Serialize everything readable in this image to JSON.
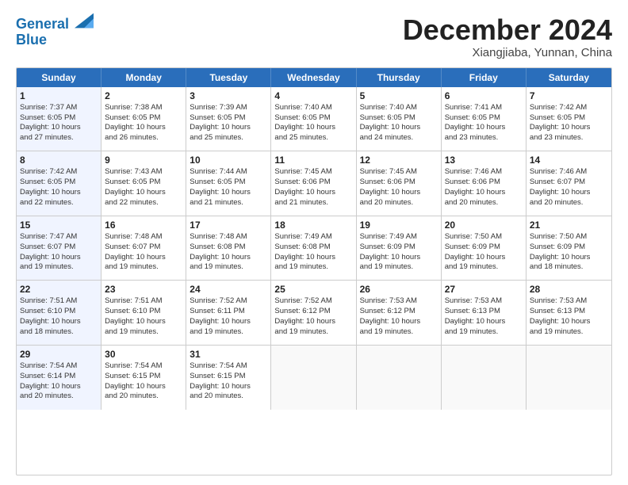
{
  "logo": {
    "line1": "General",
    "line2": "Blue"
  },
  "title": "December 2024",
  "location": "Xiangjiaba, Yunnan, China",
  "weekdays": [
    "Sunday",
    "Monday",
    "Tuesday",
    "Wednesday",
    "Thursday",
    "Friday",
    "Saturday"
  ],
  "weeks": [
    [
      {
        "day": "1",
        "lines": [
          "Sunrise: 7:37 AM",
          "Sunset: 6:05 PM",
          "Daylight: 10 hours",
          "and 27 minutes."
        ],
        "type": "sunday"
      },
      {
        "day": "2",
        "lines": [
          "Sunrise: 7:38 AM",
          "Sunset: 6:05 PM",
          "Daylight: 10 hours",
          "and 26 minutes."
        ],
        "type": "normal"
      },
      {
        "day": "3",
        "lines": [
          "Sunrise: 7:39 AM",
          "Sunset: 6:05 PM",
          "Daylight: 10 hours",
          "and 25 minutes."
        ],
        "type": "normal"
      },
      {
        "day": "4",
        "lines": [
          "Sunrise: 7:40 AM",
          "Sunset: 6:05 PM",
          "Daylight: 10 hours",
          "and 25 minutes."
        ],
        "type": "normal"
      },
      {
        "day": "5",
        "lines": [
          "Sunrise: 7:40 AM",
          "Sunset: 6:05 PM",
          "Daylight: 10 hours",
          "and 24 minutes."
        ],
        "type": "normal"
      },
      {
        "day": "6",
        "lines": [
          "Sunrise: 7:41 AM",
          "Sunset: 6:05 PM",
          "Daylight: 10 hours",
          "and 23 minutes."
        ],
        "type": "normal"
      },
      {
        "day": "7",
        "lines": [
          "Sunrise: 7:42 AM",
          "Sunset: 6:05 PM",
          "Daylight: 10 hours",
          "and 23 minutes."
        ],
        "type": "normal"
      }
    ],
    [
      {
        "day": "8",
        "lines": [
          "Sunrise: 7:42 AM",
          "Sunset: 6:05 PM",
          "Daylight: 10 hours",
          "and 22 minutes."
        ],
        "type": "sunday"
      },
      {
        "day": "9",
        "lines": [
          "Sunrise: 7:43 AM",
          "Sunset: 6:05 PM",
          "Daylight: 10 hours",
          "and 22 minutes."
        ],
        "type": "normal"
      },
      {
        "day": "10",
        "lines": [
          "Sunrise: 7:44 AM",
          "Sunset: 6:05 PM",
          "Daylight: 10 hours",
          "and 21 minutes."
        ],
        "type": "normal"
      },
      {
        "day": "11",
        "lines": [
          "Sunrise: 7:45 AM",
          "Sunset: 6:06 PM",
          "Daylight: 10 hours",
          "and 21 minutes."
        ],
        "type": "normal"
      },
      {
        "day": "12",
        "lines": [
          "Sunrise: 7:45 AM",
          "Sunset: 6:06 PM",
          "Daylight: 10 hours",
          "and 20 minutes."
        ],
        "type": "normal"
      },
      {
        "day": "13",
        "lines": [
          "Sunrise: 7:46 AM",
          "Sunset: 6:06 PM",
          "Daylight: 10 hours",
          "and 20 minutes."
        ],
        "type": "normal"
      },
      {
        "day": "14",
        "lines": [
          "Sunrise: 7:46 AM",
          "Sunset: 6:07 PM",
          "Daylight: 10 hours",
          "and 20 minutes."
        ],
        "type": "normal"
      }
    ],
    [
      {
        "day": "15",
        "lines": [
          "Sunrise: 7:47 AM",
          "Sunset: 6:07 PM",
          "Daylight: 10 hours",
          "and 19 minutes."
        ],
        "type": "sunday"
      },
      {
        "day": "16",
        "lines": [
          "Sunrise: 7:48 AM",
          "Sunset: 6:07 PM",
          "Daylight: 10 hours",
          "and 19 minutes."
        ],
        "type": "normal"
      },
      {
        "day": "17",
        "lines": [
          "Sunrise: 7:48 AM",
          "Sunset: 6:08 PM",
          "Daylight: 10 hours",
          "and 19 minutes."
        ],
        "type": "normal"
      },
      {
        "day": "18",
        "lines": [
          "Sunrise: 7:49 AM",
          "Sunset: 6:08 PM",
          "Daylight: 10 hours",
          "and 19 minutes."
        ],
        "type": "normal"
      },
      {
        "day": "19",
        "lines": [
          "Sunrise: 7:49 AM",
          "Sunset: 6:09 PM",
          "Daylight: 10 hours",
          "and 19 minutes."
        ],
        "type": "normal"
      },
      {
        "day": "20",
        "lines": [
          "Sunrise: 7:50 AM",
          "Sunset: 6:09 PM",
          "Daylight: 10 hours",
          "and 19 minutes."
        ],
        "type": "normal"
      },
      {
        "day": "21",
        "lines": [
          "Sunrise: 7:50 AM",
          "Sunset: 6:09 PM",
          "Daylight: 10 hours",
          "and 18 minutes."
        ],
        "type": "normal"
      }
    ],
    [
      {
        "day": "22",
        "lines": [
          "Sunrise: 7:51 AM",
          "Sunset: 6:10 PM",
          "Daylight: 10 hours",
          "and 18 minutes."
        ],
        "type": "sunday"
      },
      {
        "day": "23",
        "lines": [
          "Sunrise: 7:51 AM",
          "Sunset: 6:10 PM",
          "Daylight: 10 hours",
          "and 19 minutes."
        ],
        "type": "normal"
      },
      {
        "day": "24",
        "lines": [
          "Sunrise: 7:52 AM",
          "Sunset: 6:11 PM",
          "Daylight: 10 hours",
          "and 19 minutes."
        ],
        "type": "normal"
      },
      {
        "day": "25",
        "lines": [
          "Sunrise: 7:52 AM",
          "Sunset: 6:12 PM",
          "Daylight: 10 hours",
          "and 19 minutes."
        ],
        "type": "normal"
      },
      {
        "day": "26",
        "lines": [
          "Sunrise: 7:53 AM",
          "Sunset: 6:12 PM",
          "Daylight: 10 hours",
          "and 19 minutes."
        ],
        "type": "normal"
      },
      {
        "day": "27",
        "lines": [
          "Sunrise: 7:53 AM",
          "Sunset: 6:13 PM",
          "Daylight: 10 hours",
          "and 19 minutes."
        ],
        "type": "normal"
      },
      {
        "day": "28",
        "lines": [
          "Sunrise: 7:53 AM",
          "Sunset: 6:13 PM",
          "Daylight: 10 hours",
          "and 19 minutes."
        ],
        "type": "normal"
      }
    ],
    [
      {
        "day": "29",
        "lines": [
          "Sunrise: 7:54 AM",
          "Sunset: 6:14 PM",
          "Daylight: 10 hours",
          "and 20 minutes."
        ],
        "type": "sunday"
      },
      {
        "day": "30",
        "lines": [
          "Sunrise: 7:54 AM",
          "Sunset: 6:15 PM",
          "Daylight: 10 hours",
          "and 20 minutes."
        ],
        "type": "normal"
      },
      {
        "day": "31",
        "lines": [
          "Sunrise: 7:54 AM",
          "Sunset: 6:15 PM",
          "Daylight: 10 hours",
          "and 20 minutes."
        ],
        "type": "normal"
      },
      {
        "day": "",
        "lines": [],
        "type": "empty"
      },
      {
        "day": "",
        "lines": [],
        "type": "empty"
      },
      {
        "day": "",
        "lines": [],
        "type": "empty"
      },
      {
        "day": "",
        "lines": [],
        "type": "empty"
      }
    ]
  ]
}
